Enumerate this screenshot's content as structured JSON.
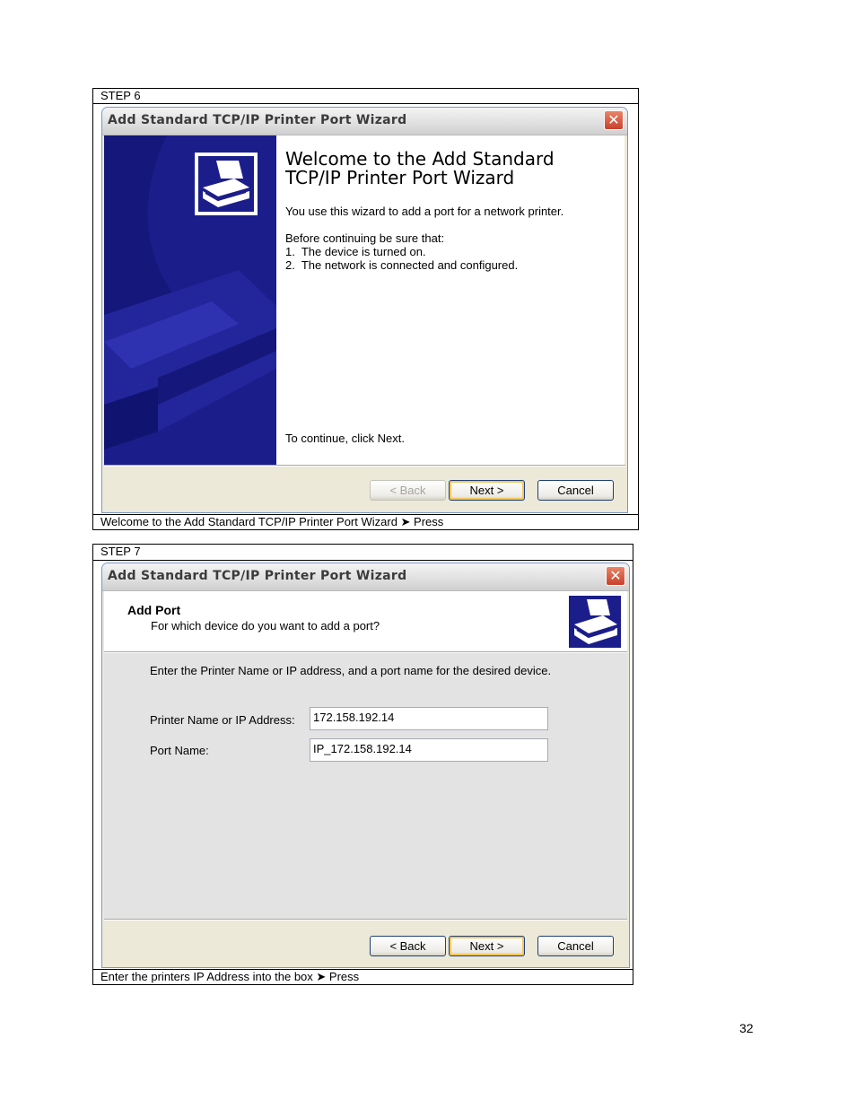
{
  "step6": {
    "label": "STEP 6",
    "caption": "Welcome to the Add Standard TCP/IP Printer Port Wizard ➤ Press",
    "window": {
      "title": "Add Standard TCP/IP Printer Port Wizard",
      "heading_line1": "Welcome to the Add Standard",
      "heading_line2": "TCP/IP Printer Port Wizard",
      "intro": "You use this wizard to add a port for a network printer.",
      "before": "Before continuing be sure that:",
      "item1": "1.  The device is turned on.",
      "item2": "2.  The network is connected and configured.",
      "continue": "To continue, click Next.",
      "back_label": "< Back",
      "next_label": "Next >",
      "cancel_label": "Cancel"
    }
  },
  "step7": {
    "label": "STEP 7",
    "caption": "Enter the printers IP Address into the box ➤ Press",
    "window": {
      "title": "Add Standard TCP/IP Printer Port Wizard",
      "header_title": "Add Port",
      "header_subtitle": "For which device do you want to add a port?",
      "instruction": "Enter the Printer Name or IP address, and a port name for the desired device.",
      "printer_label": "Printer Name or IP Address:",
      "printer_value": "172.158.192.14",
      "port_label": "Port Name:",
      "port_value": "IP_172.158.192.14",
      "back_label": "< Back",
      "next_label": "Next >",
      "cancel_label": "Cancel"
    }
  },
  "page_number": "32",
  "colors": {
    "wizard_blue": "#1b1d8a",
    "dialog_bg": "#ece9d8",
    "close_red": "#c8412c"
  },
  "icons": {
    "close": "close-icon",
    "printer": "printer-icon"
  }
}
